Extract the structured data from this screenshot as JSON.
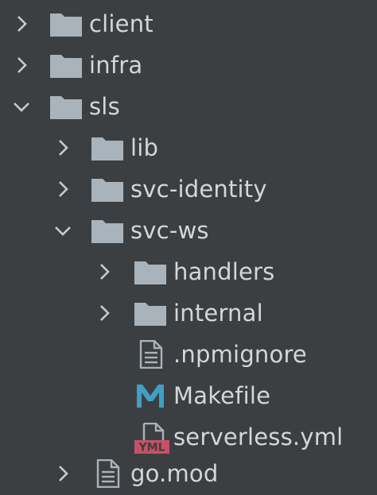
{
  "tree": {
    "client": {
      "label": "client",
      "expanded": false,
      "icon": "folder-icon"
    },
    "infra": {
      "label": "infra",
      "expanded": false,
      "icon": "folder-icon"
    },
    "sls": {
      "label": "sls",
      "expanded": true,
      "icon": "folder-icon",
      "children": {
        "lib": {
          "label": "lib",
          "expanded": false,
          "icon": "folder-icon"
        },
        "svc_identity": {
          "label": "svc-identity",
          "expanded": false,
          "icon": "folder-icon"
        },
        "svc_ws": {
          "label": "svc-ws",
          "expanded": true,
          "icon": "folder-icon",
          "children": {
            "handlers": {
              "label": "handlers",
              "expanded": false,
              "icon": "folder-icon"
            },
            "internal": {
              "label": "internal",
              "expanded": false,
              "icon": "folder-icon"
            },
            "npmignore": {
              "label": ".npmignore",
              "icon": "text-file-icon"
            },
            "makefile": {
              "label": "Makefile",
              "icon": "makefile-icon",
              "badge": "M"
            },
            "serverless": {
              "label": "serverless.yml",
              "icon": "yaml-file-icon",
              "badge": "YML"
            }
          }
        },
        "go_mod": {
          "label": "go.mod",
          "icon": "text-file-icon"
        }
      }
    }
  },
  "colors": {
    "background": "#3c3f41",
    "folder": "#a9b3bc",
    "text": "#d4d6d9",
    "chevron": "#c8cbce",
    "makefile_accent": "#3f9fc6",
    "yaml_badge": "#c94f68"
  }
}
